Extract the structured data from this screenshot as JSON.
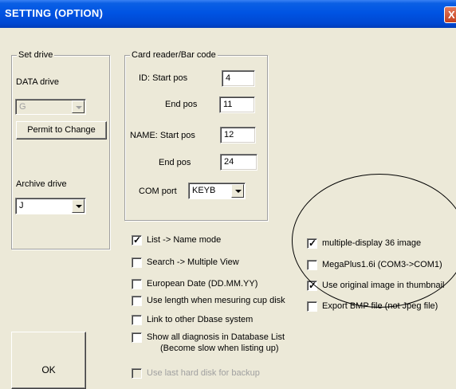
{
  "window": {
    "title": "SETTING (OPTION)",
    "close_glyph": "X"
  },
  "set_drive": {
    "legend": "Set drive",
    "data_drive_label": "DATA drive",
    "data_drive_value": "G",
    "permit_button": "Permit to Change",
    "archive_drive_label": "Archive drive",
    "archive_drive_value": "J"
  },
  "card_reader": {
    "legend": "Card reader/Bar code",
    "id_start_label": "ID: Start pos",
    "id_start_value": "4",
    "id_end_label": "End pos",
    "id_end_value": "11",
    "name_start_label": "NAME: Start pos",
    "name_start_value": "12",
    "name_end_label": "End pos",
    "name_end_value": "24",
    "com_port_label": "COM port",
    "com_port_value": "KEYB"
  },
  "options_left": [
    {
      "label": "List -> Name mode",
      "checked": true
    },
    {
      "label": "Search -> Multiple View",
      "checked": false
    },
    {
      "label": "European Date (DD.MM.YY)",
      "checked": false
    },
    {
      "label": "Use length when mesuring cup disk",
      "checked": false
    },
    {
      "label": "Link to other Dbase system",
      "checked": false
    },
    {
      "label": "Show all diagnosis in Database List",
      "label2": "(Become slow when listing up)",
      "checked": false
    },
    {
      "label": "Use last hard disk for backup",
      "checked": false,
      "disabled": true
    }
  ],
  "options_right": [
    {
      "label": "multiple-display 36 image",
      "checked": true
    },
    {
      "label": "MegaPlus1.6i (COM3->COM1)",
      "checked": false
    },
    {
      "label": "Use original image in thumbnail",
      "checked": true
    },
    {
      "label": "Export BMP file (not Jpeg file)",
      "checked": false
    }
  ],
  "ok_button": "OK",
  "colors": {
    "titlebar": "#0054e3",
    "dialog_bg": "#ece9d8",
    "close_button": "#c4401d"
  }
}
